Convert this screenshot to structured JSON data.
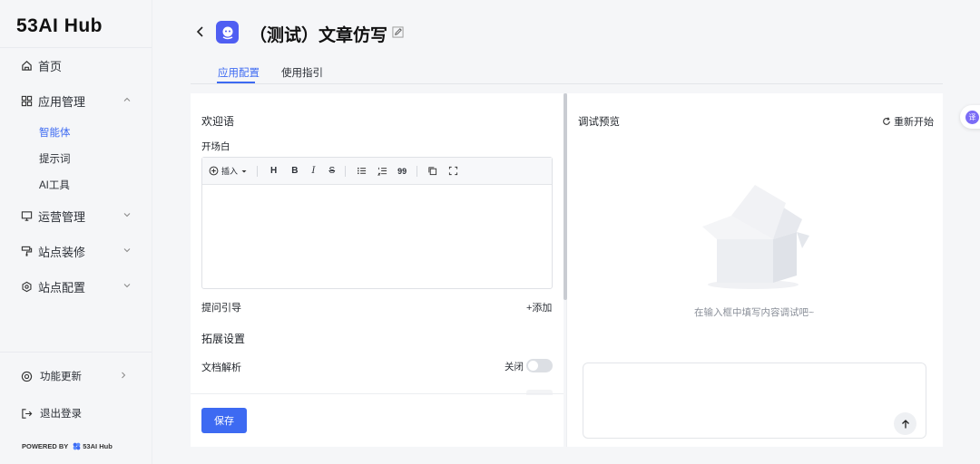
{
  "sidebar": {
    "logo": "53AI Hub",
    "items": [
      {
        "label": "首页",
        "icon": "home-icon"
      },
      {
        "label": "应用管理",
        "icon": "grid-icon"
      },
      {
        "label": "运营管理",
        "icon": "monitor-icon"
      },
      {
        "label": "站点装修",
        "icon": "paint-roller-icon"
      },
      {
        "label": "站点配置",
        "icon": "gear-icon"
      }
    ],
    "sub_items": [
      "智能体",
      "提示词",
      "AI工具"
    ],
    "bottom": {
      "updates": "功能更新",
      "logout": "退出登录",
      "powered_by": "POWERED BY",
      "powered_logo": "53AI Hub"
    }
  },
  "header": {
    "title": "（测试）文章仿写",
    "tabs": [
      "应用配置",
      "使用指引"
    ]
  },
  "config": {
    "welcome_heading": "欢迎语",
    "opening_label": "开场白",
    "toolbar": {
      "insert": "插入",
      "heading": "H",
      "bold": "B",
      "italic": "I",
      "strike": "S",
      "quote": "99"
    },
    "question_guide": "提问引导",
    "add": "+添加",
    "extension_heading": "拓展设置",
    "doc_parse": "文档解析",
    "off": "关闭",
    "save": "保存"
  },
  "preview": {
    "heading": "调试预览",
    "restart": "重新开始",
    "empty_hint": "在输入框中填写内容调试吧~"
  },
  "translate_fab": "译",
  "colors": {
    "accent": "#3d6af2",
    "avatar": "#4f5ef2"
  }
}
